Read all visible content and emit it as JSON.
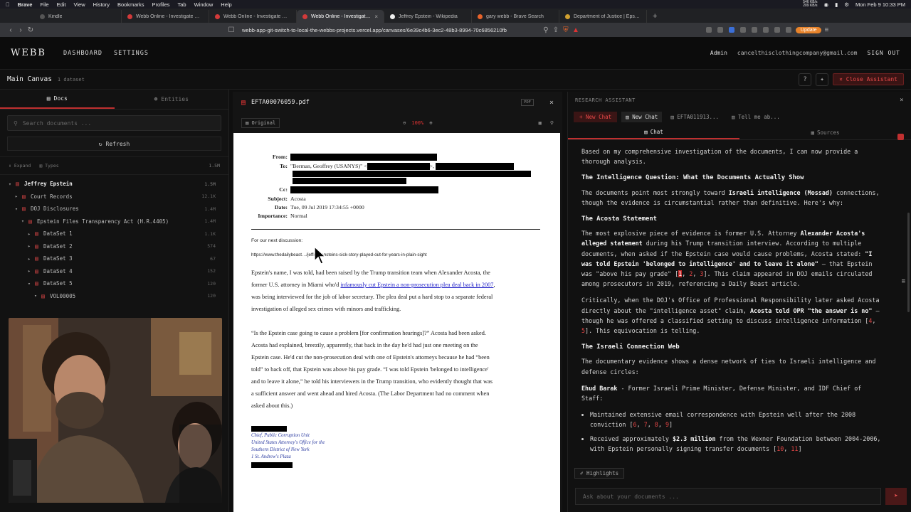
{
  "menubar": {
    "app": "Brave",
    "items": [
      "File",
      "Edit",
      "View",
      "History",
      "Bookmarks",
      "Profiles",
      "Tab",
      "Window",
      "Help"
    ],
    "netstat": "546 KB/s\n209 KB/s",
    "clock": "Mon Feb 9  10:33 PM"
  },
  "tabs": [
    {
      "label": "Kindle",
      "color": "#2a2a2a"
    },
    {
      "label": "Webb Online - Investigate Documents",
      "color": "#d23a3a"
    },
    {
      "label": "Webb Online - Investigate Docum...",
      "color": "#d23a3a"
    },
    {
      "label": "Webb Online - Investigate Doc",
      "color": "#d23a3a",
      "active": true
    },
    {
      "label": "Jeffrey Epstein - Wikipedia",
      "color": "#ffffff"
    },
    {
      "label": "gary webb - Brave Search",
      "color": "#e8632a"
    },
    {
      "label": "Department of Justice | Epstein Lib...",
      "color": "#d0a030"
    }
  ],
  "browser": {
    "url": "webb-app-git-switch-to-local-the-webbs-projects.vercel.app/canvases/6e39c4b6-3ec2-48b3-8994-70c6856210fb",
    "update": "Update"
  },
  "header": {
    "logo": "WEBB",
    "nav": [
      "DASHBOARD",
      "SETTINGS"
    ],
    "role": "Admin",
    "email": "cancelthisclothingcompany@gmail.com",
    "signout": "SIGN OUT"
  },
  "canvas": {
    "title": "Main Canvas",
    "subtitle": "1 dataset",
    "close_assistant": "Close Assistant"
  },
  "left": {
    "tab_docs": "Docs",
    "tab_entities": "Entities",
    "search_placeholder": "Search documents ...",
    "refresh": "Refresh",
    "expand": "Expand",
    "types": "Types",
    "total": "1.5M",
    "tree": [
      {
        "label": "Jeffrey Epstein",
        "count": "1.5M",
        "indent": 0,
        "root": true,
        "open": true
      },
      {
        "label": "Court Records",
        "count": "12.1K",
        "indent": 1,
        "open": false
      },
      {
        "label": "DOJ Disclosures",
        "count": "1.4M",
        "indent": 1,
        "open": true
      },
      {
        "label": "Epstein Files Transparency Act (H.R.4405)",
        "count": "1.4M",
        "indent": 2,
        "open": true
      },
      {
        "label": "DataSet 1",
        "count": "1.1K",
        "indent": 3,
        "open": false
      },
      {
        "label": "DataSet 2",
        "count": "574",
        "indent": 3,
        "open": false
      },
      {
        "label": "DataSet 3",
        "count": "67",
        "indent": 3,
        "open": false
      },
      {
        "label": "DataSet 4",
        "count": "152",
        "indent": 3,
        "open": false
      },
      {
        "label": "DataSet 5",
        "count": "120",
        "indent": 3,
        "open": true
      },
      {
        "label": "VOL00005",
        "count": "120",
        "indent": 4,
        "open": true
      }
    ]
  },
  "pdf": {
    "filename": "EFTA00076059.pdf",
    "badge": "PDF",
    "original": "Original",
    "zoom": "100%",
    "from_label": "From:",
    "to_label": "To:",
    "to_value": "\"Berman, Geoffrey (USANYS)\" <",
    "cc_label": "Cc:",
    "subject_label": "Subject:",
    "subject": "Acosta",
    "date_label": "Date:",
    "date": "Tue, 09 Jul 2019 17:34:55 +0000",
    "importance_label": "Importance:",
    "importance": "Normal",
    "intro": "For our next discussion:",
    "link_a": "https://www.thedailybeast",
    "link_b": "/jeffrey-epsteins-sick-story-played-out-for-years-in-plain-sight",
    "p1_a": "Epstein's name, I was told, had been raised by the Trump transition team when Alexander Acosta, the",
    "p1_b_pre": "former U.S. attorney in Miami who'd ",
    "p1_b_link": "infamously cut Epstein a non-prosecution plea deal back in 2007",
    "p1_b_post": ",",
    "p1_c": "was being interviewed for the job of labor secretary. The plea deal put a hard stop to a separate federal",
    "p1_d": "investigation of alleged sex crimes with minors and trafficking.",
    "p2_a": "“Is the Epstein case going to cause a problem [for confirmation hearings]?” Acosta had been asked.",
    "p2_b": "Acosta had explained, breezily, apparently, that back in the day he'd had just one meeting on the",
    "p2_c": "Epstein case. He'd cut the non-prosecution deal with one of Epstein's attorneys because he had “been",
    "p2_d": "told” to back off, that Epstein was above his pay grade. “I was told Epstein 'belonged to intelligence'",
    "p2_e": "and to leave it alone,” he told his interviewers in the Trump transition, who evidently thought that was",
    "p2_f": "a sufficient answer and went ahead and hired Acosta. (The Labor Department had no comment when",
    "p2_g": "asked about this.)",
    "sig_1": "Chief, Public Corruption Unit",
    "sig_2": "United States Attorney's Office for the",
    "sig_3": "Southern District of New York",
    "sig_4": "1 St. Andrew's Plaza"
  },
  "assistant": {
    "header": "RESEARCH ASSISTANT",
    "new_chat_btn": "+ New Chat",
    "chat_tabs": [
      "New Chat",
      "EFTA011913...",
      "Tell me ab..."
    ],
    "tab_chat": "Chat",
    "tab_sources": "Sources",
    "intro": "Based on my comprehensive investigation of the documents, I can now provide a thorough analysis.",
    "h1": "The Intelligence Question: What the Documents Actually Show",
    "p1_a": "The documents point most strongly toward ",
    "p1_b": "Israeli intelligence (Mossad)",
    "p1_c": " connections, though the evidence is circumstantial rather than definitive. Here's why:",
    "h2": "The Acosta Statement",
    "p2_a": "The most explosive piece of evidence is former U.S. Attorney ",
    "p2_b": "Alexander Acosta's alleged statement",
    "p2_c": " during his Trump transition interview. According to multiple documents, when asked if the Epstein case would cause problems, Acosta stated: ",
    "p2_d": "\"I was told Epstein 'belonged to intelligence' and to leave it alone\"",
    "p2_e": " — that Epstein was \"above his pay grade\" [",
    "c1": "1",
    "c2": "2",
    "c3": "3",
    "p2_f": "]. This claim appeared in DOJ emails circulated among prosecutors in 2019, referencing a Daily Beast article.",
    "p3_a": "Critically, when the DOJ's Office of Professional Responsibility later asked Acosta directly about the \"intelligence asset\" claim, ",
    "p3_b": "Acosta told OPR \"the answer is no\"",
    "p3_c": " — though he was offered a classified setting to discuss intelligence information [",
    "c4": "4",
    "c5": "5",
    "p3_d": "]. This equivocation is telling.",
    "h3": "The Israeli Connection Web",
    "p4": "The documentary evidence shows a dense network of ties to Israeli intelligence and defense circles:",
    "p5_a": "Ehud Barak",
    "p5_b": " - Former Israeli Prime Minister, Defense Minister, and IDF Chief of Staff:",
    "li1_a": "Maintained extensive email correspondence with Epstein well after the 2008 conviction [",
    "c6": "6",
    "c7": "7",
    "c8": "8",
    "c9": "9",
    "li1_b": "]",
    "li2_a": "Received approximately ",
    "li2_b": "$2.3 million",
    "li2_c": " from the Wexner Foundation between 2004-2006, with Epstein personally signing transfer documents [",
    "c10": "10",
    "c11": "11",
    "li2_d": "]",
    "highlights": "Highlights",
    "input_placeholder": "Ask about your documents ..."
  }
}
